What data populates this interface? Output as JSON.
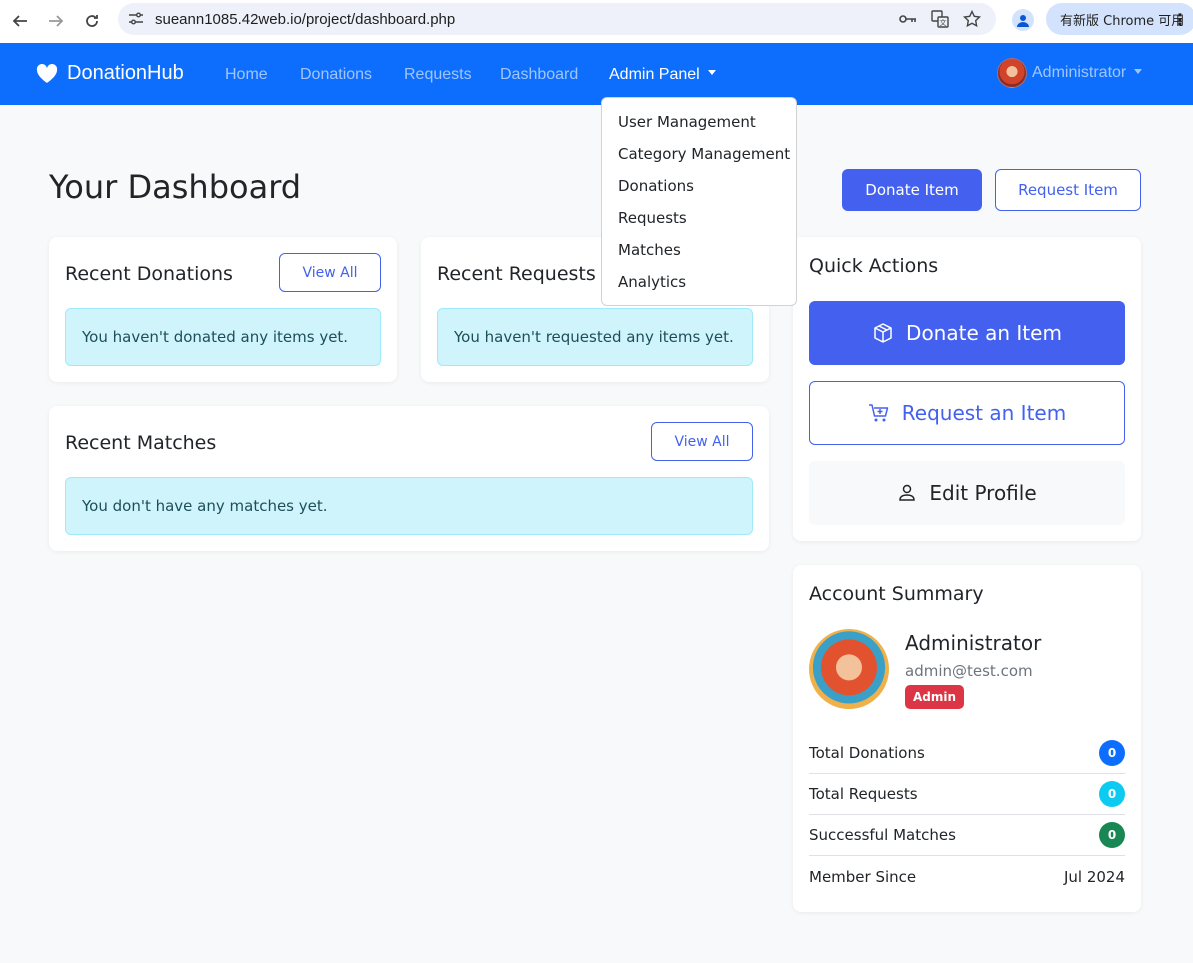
{
  "browser": {
    "url": "sueann1085.42web.io/project/dashboard.php",
    "update_label": "有新版 Chrome 可用"
  },
  "navbar": {
    "brand": "DonationHub",
    "links": [
      "Home",
      "Donations",
      "Requests",
      "Dashboard"
    ],
    "admin_label": "Admin Panel",
    "user_label": "Administrator"
  },
  "admin_menu": {
    "items": [
      "User Management",
      "Category Management",
      "Donations",
      "Requests",
      "Matches",
      "Analytics"
    ]
  },
  "page": {
    "title": "Your Dashboard",
    "donate_btn": "Donate Item",
    "request_btn": "Request Item"
  },
  "recent_donations": {
    "title": "Recent Donations",
    "view_all": "View All",
    "empty": "You haven't donated any items yet."
  },
  "recent_requests": {
    "title": "Recent Requests",
    "empty": "You haven't requested any items yet."
  },
  "recent_matches": {
    "title": "Recent Matches",
    "view_all": "View All",
    "empty": "You don't have any matches yet."
  },
  "quick_actions": {
    "title": "Quick Actions",
    "donate": "Donate an Item",
    "request": "Request an Item",
    "edit": "Edit Profile"
  },
  "account": {
    "title": "Account Summary",
    "name": "Administrator",
    "email": "admin@test.com",
    "role": "Admin",
    "stats": [
      {
        "label": "Total Donations",
        "value": "0",
        "color": "#0d6efd"
      },
      {
        "label": "Total Requests",
        "value": "0",
        "color": "#0dcaf0"
      },
      {
        "label": "Successful Matches",
        "value": "0",
        "color": "#198754"
      }
    ],
    "member_since_label": "Member Since",
    "member_since_value": "Jul 2024"
  },
  "colors": {
    "navbar": "#0d6efd",
    "accent": "#4361ee",
    "alert_bg": "#cff4fc",
    "danger": "#dc3545"
  }
}
